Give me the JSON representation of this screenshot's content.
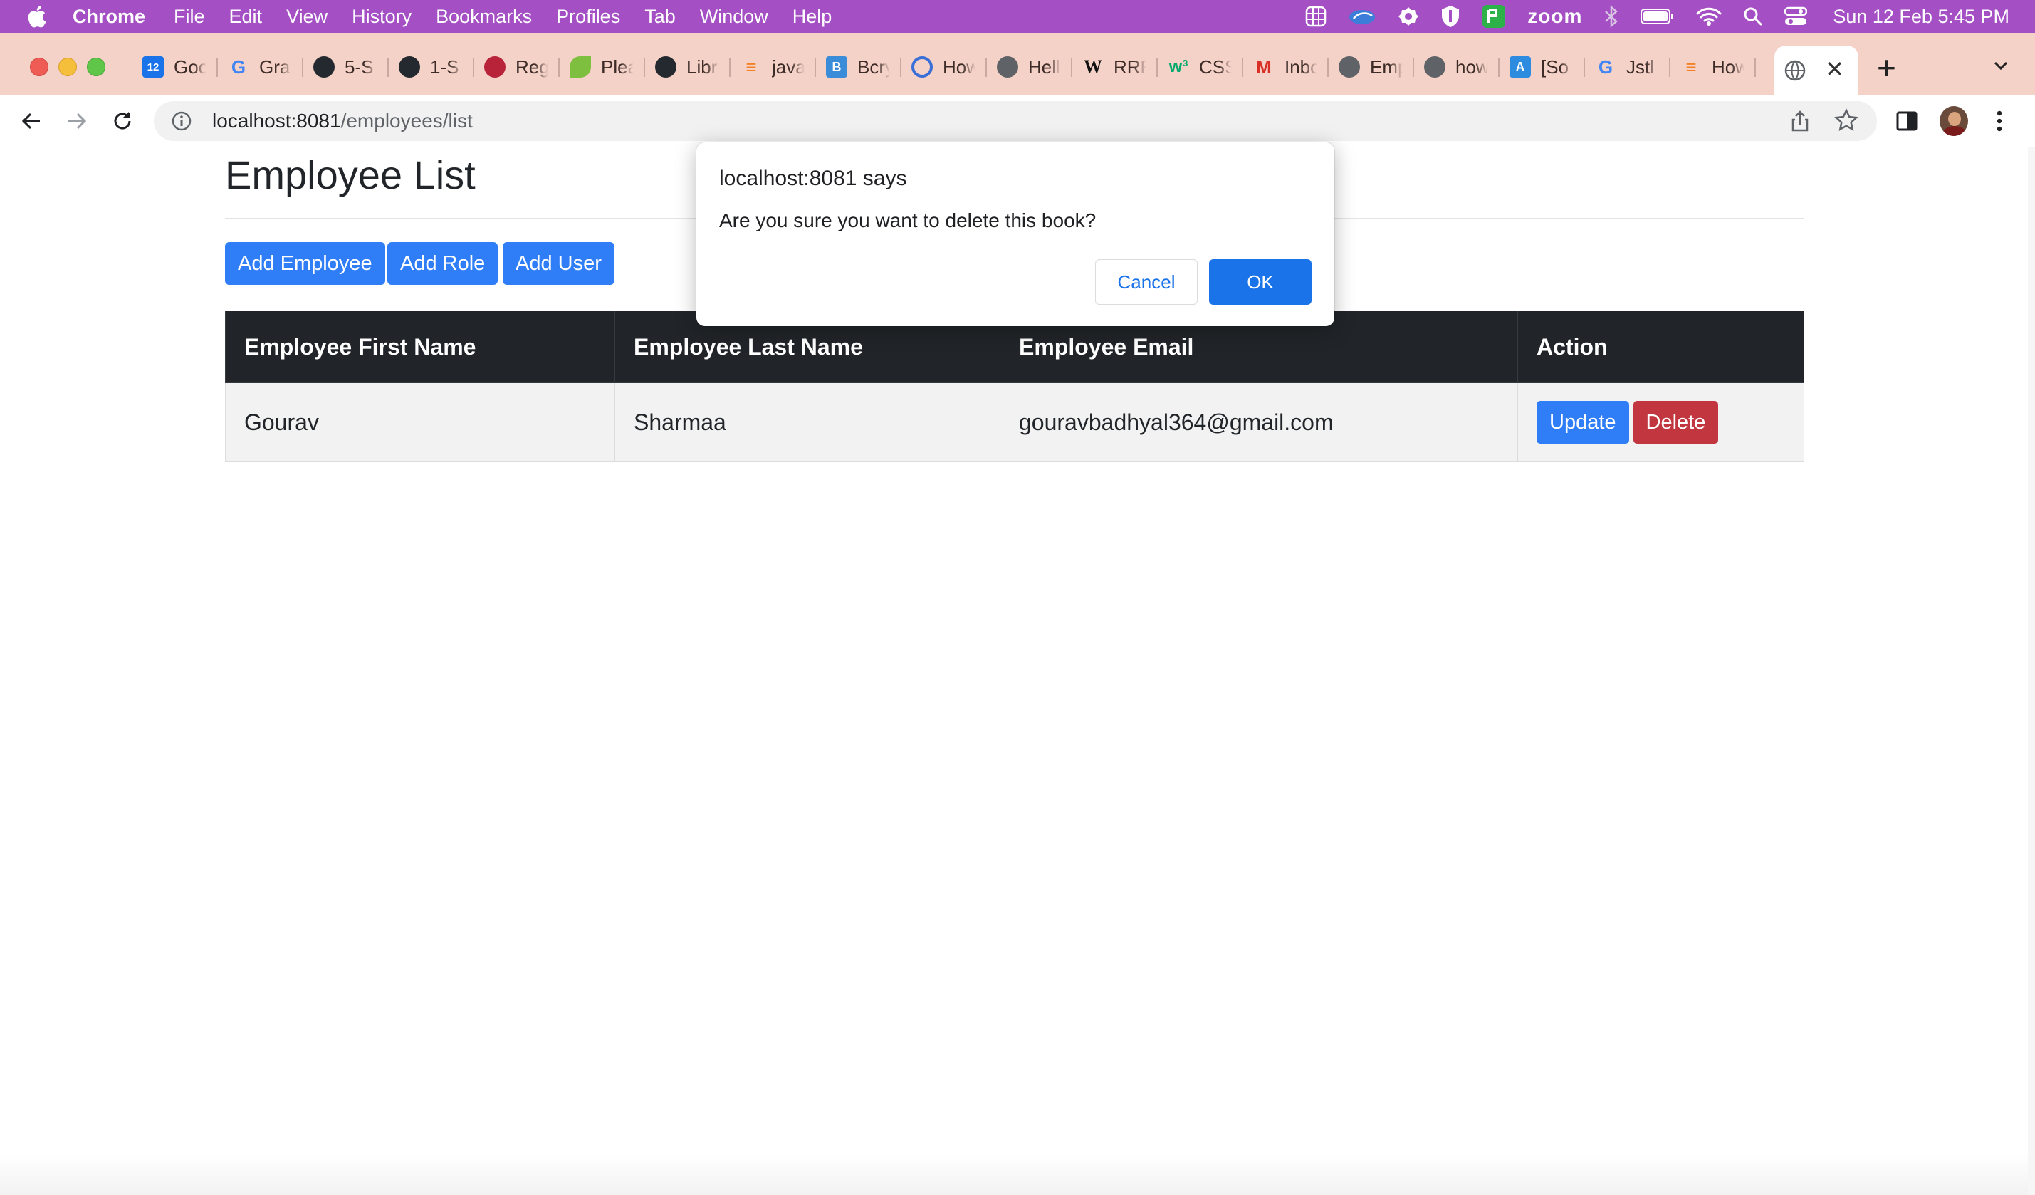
{
  "menubar": {
    "app": "Chrome",
    "items": [
      "File",
      "Edit",
      "View",
      "History",
      "Bookmarks",
      "Profiles",
      "Tab",
      "Window",
      "Help"
    ],
    "status_zoom": "zoom",
    "clock": "Sun 12 Feb  5:45 PM",
    "bg_color": "#a44fc4"
  },
  "tabs": [
    {
      "title": "Goo",
      "icon": "calendar-icon"
    },
    {
      "title": "Gra",
      "icon": "google-icon"
    },
    {
      "title": "5-S",
      "icon": "github-icon"
    },
    {
      "title": "1-S",
      "icon": "github-icon"
    },
    {
      "title": "Reg",
      "icon": "site-icon"
    },
    {
      "title": "Plea",
      "icon": "spring-leaf-icon"
    },
    {
      "title": "Libr",
      "icon": "github-icon"
    },
    {
      "title": "java",
      "icon": "stackoverflow-icon"
    },
    {
      "title": "Bcry",
      "icon": "b-icon"
    },
    {
      "title": "How",
      "icon": "refresh-site-icon"
    },
    {
      "title": "Hell",
      "icon": "globe-icon"
    },
    {
      "title": "RRF",
      "icon": "wikipedia-icon"
    },
    {
      "title": "CSS",
      "icon": "w3schools-icon"
    },
    {
      "title": "Inbo",
      "icon": "gmail-icon"
    },
    {
      "title": "Emp",
      "icon": "globe-icon"
    },
    {
      "title": "how",
      "icon": "globe-icon"
    },
    {
      "title": "[So",
      "icon": "site-icon"
    },
    {
      "title": "Jstl",
      "icon": "google-icon"
    },
    {
      "title": "How",
      "icon": "stackoverflow-icon"
    }
  ],
  "browser": {
    "url_host": "localhost:8081",
    "url_path": "/employees/list"
  },
  "page": {
    "title": "Employee List",
    "buttons": {
      "add_employee": "Add Employee",
      "add_role": "Add Role",
      "add_user": "Add User"
    },
    "table": {
      "headers": [
        "Employee First Name",
        "Employee Last Name",
        "Employee Email",
        "Action"
      ],
      "rows": [
        {
          "first_name": "Gourav",
          "last_name": "Sharmaa",
          "email": "gouravbadhyal364@gmail.com",
          "update": "Update",
          "delete": "Delete"
        }
      ]
    }
  },
  "dialog": {
    "title": "localhost:8081 says",
    "message": "Are you sure you want to delete this book?",
    "cancel": "Cancel",
    "ok": "OK"
  },
  "colors": {
    "primary": "#2f7ef7",
    "danger": "#c1363f",
    "table_header": "#212529",
    "dialog_ok": "#1a73e8"
  }
}
